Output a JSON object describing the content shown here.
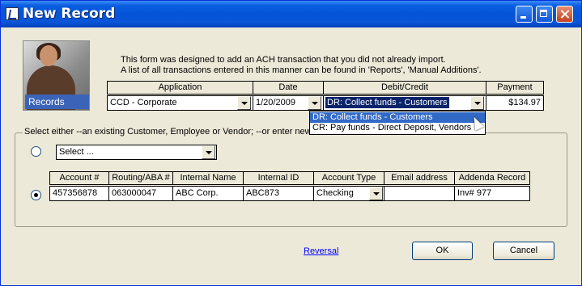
{
  "window": {
    "title": "New Record"
  },
  "logo": {
    "label": "Records"
  },
  "info": {
    "line1": "This form was designed to add an ACH transaction that you did not already import.",
    "line2": "A list of all transactions entered in this manner can be found in 'Reports', 'Manual Additions'."
  },
  "txn": {
    "headers": {
      "application": "Application",
      "date": "Date",
      "debit_credit": "Debit/Credit",
      "payment": "Payment"
    },
    "application": "CCD - Corporate",
    "date": "1/20/2009",
    "debit_credit": "DR: Collect funds - Customers",
    "payment": "$134.97"
  },
  "debit_credit_options": [
    "DR: Collect funds - Customers",
    "CR: Pay funds - Direct Deposit, Vendors"
  ],
  "group": {
    "title": "Select either --an existing Customer, Employee or Vendor;  --or enter new info"
  },
  "existing": {
    "select_value": "Select ..."
  },
  "entry": {
    "headers": {
      "account": "Account #",
      "routing": "Routing/ABA #",
      "name": "Internal Name",
      "internal_id": "Internal ID",
      "type": "Account Type",
      "email": "Email address",
      "addenda": "Addenda Record"
    },
    "account": "457356878",
    "routing": "063000047",
    "name": "ABC Corp.",
    "internal_id": "ABC873",
    "type": "Checking",
    "email": "",
    "addenda": "Inv# 977"
  },
  "footer": {
    "reversal": "Reversal",
    "ok": "OK",
    "cancel": "Cancel"
  }
}
